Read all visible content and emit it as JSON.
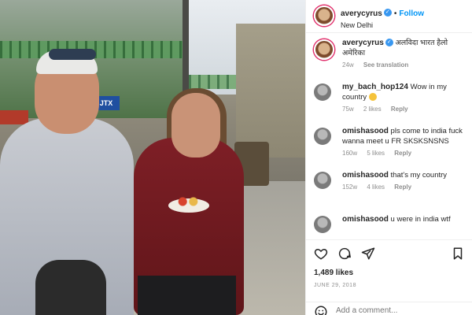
{
  "post": {
    "author": "averycyrus",
    "location": "New Delhi",
    "follow_label": "Follow",
    "separator": "•",
    "photo_sign_text": "JTX"
  },
  "caption": {
    "username": "averycyrus",
    "text": "अलविदा भारत हैलो अमेरिका",
    "time": "24w",
    "see_translation": "See translation"
  },
  "comments": [
    {
      "username": "my_bach_hop124",
      "text": "Wow in my country",
      "emoji": "face-emoji",
      "time": "75w",
      "likes": "2 likes",
      "reply": "Reply"
    },
    {
      "username": "omishasood",
      "text": "pls come to india fuck wanna meet u FR SKSKSNSNS",
      "time": "160w",
      "likes": "5 likes",
      "reply": "Reply"
    },
    {
      "username": "omishasood",
      "text": "that's my country",
      "time": "152w",
      "likes": "4 likes",
      "reply": "Reply"
    },
    {
      "username": "omishasood",
      "text": "u were in india wtf",
      "time": "",
      "likes": "",
      "reply": ""
    }
  ],
  "actions": {
    "likes": "1,489 likes",
    "date": "JUNE 29, 2018"
  },
  "composer": {
    "placeholder": "Add a comment..."
  },
  "colors": {
    "follow": "#0095f6",
    "verified": "#3897f0",
    "story_ring": "#e1306c",
    "muted": "#8e8e8e"
  }
}
